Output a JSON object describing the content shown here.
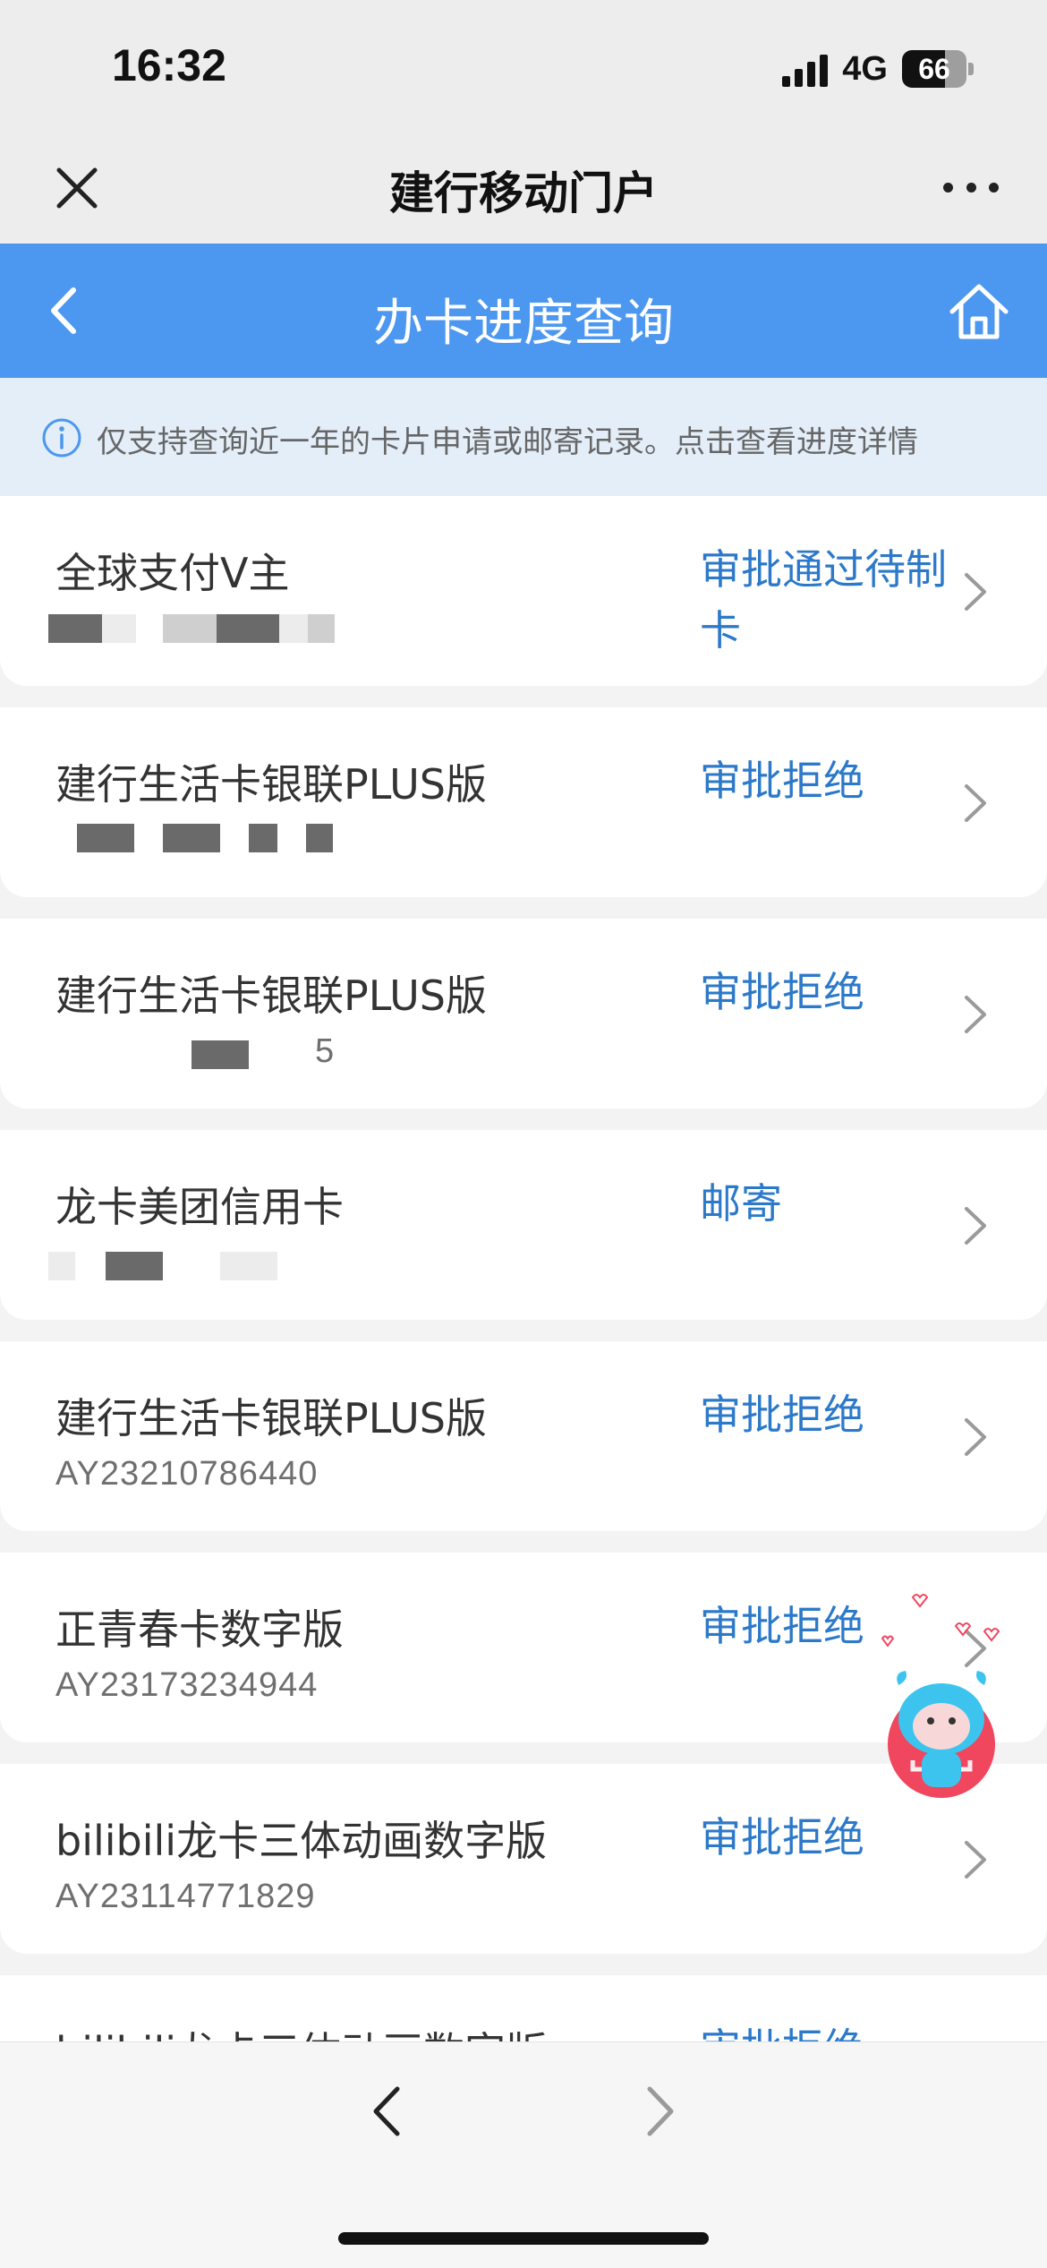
{
  "status_bar": {
    "time": "16:32",
    "network": "4G",
    "battery": "66",
    "battery_level": 0.66
  },
  "title_bar": {
    "title": "建行移动门户",
    "close_icon": "close-icon",
    "more_icon": "more-icon"
  },
  "header": {
    "title": "办卡进度查询",
    "back_icon": "back-icon",
    "home_icon": "home-icon",
    "background": "#4c97f0"
  },
  "notice": {
    "icon": "info-icon",
    "text": "仅支持查询近一年的卡片申请或邮寄记录。点击查看进度详情"
  },
  "applications": [
    {
      "name": "全球支付V主",
      "sub": "",
      "status": "审批通过待制卡"
    },
    {
      "name": "建行生活卡银联PLUS版",
      "sub": "",
      "status": "审批拒绝"
    },
    {
      "name": "建行生活卡银联PLUS版",
      "sub": "5",
      "status": "审批拒绝"
    },
    {
      "name": "龙卡美团信用卡",
      "sub": "",
      "status": "邮寄"
    },
    {
      "name": "建行生活卡银联PLUS版",
      "sub": "AY23210786440",
      "status": "审批拒绝"
    },
    {
      "name": "正青春卡数字版",
      "sub": "AY23173234944",
      "status": "审批拒绝"
    },
    {
      "name": "bilibili龙卡三体动画数字版",
      "sub": "AY23114771829",
      "status": "审批拒绝"
    },
    {
      "name": "bilibili龙卡三体动画数字版",
      "sub": "",
      "status": "审批拒绝"
    }
  ],
  "colors": {
    "accent": "#4c97f0",
    "status_text": "#2c79c9",
    "notice_bg": "#e3eef9",
    "mascot_button": "#f0465e"
  },
  "bottom_bar": {
    "prev_icon": "chevron-left-icon",
    "next_icon": "chevron-right-icon"
  }
}
